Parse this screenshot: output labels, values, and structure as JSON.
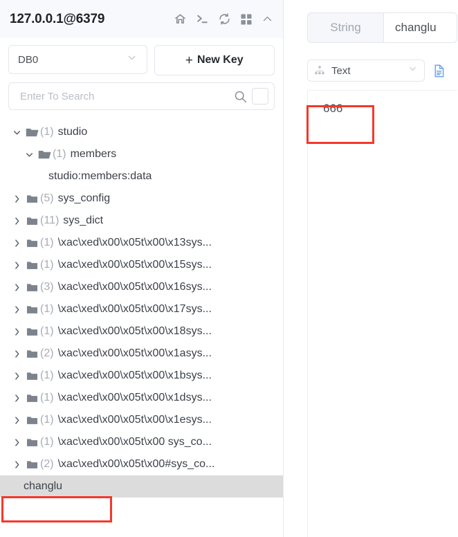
{
  "connection": {
    "title": "127.0.0.1@6379",
    "icons": [
      {
        "name": "home-icon",
        "glyph": "home"
      },
      {
        "name": "console-icon",
        "glyph": "terminal"
      },
      {
        "name": "refresh-icon",
        "glyph": "refresh"
      },
      {
        "name": "grid-icon",
        "glyph": "grid"
      },
      {
        "name": "collapse-icon",
        "glyph": "chevron-up"
      }
    ]
  },
  "toolbar": {
    "db_value": "DB0",
    "new_key_plus": "+",
    "new_key_label": "New Key"
  },
  "search": {
    "placeholder": "Enter To Search",
    "value": ""
  },
  "tree": {
    "nodes": [
      {
        "indent": 0,
        "state": "expanded",
        "folder": "open",
        "count": "(1)",
        "name": "studio",
        "selected": false
      },
      {
        "indent": 1,
        "state": "expanded",
        "folder": "open",
        "count": "(1)",
        "name": "members",
        "selected": false
      },
      {
        "indent": 2,
        "state": "leaf",
        "folder": "none",
        "count": "",
        "name": "studio:members:data",
        "selected": false
      },
      {
        "indent": 0,
        "state": "collapsed",
        "folder": "closed",
        "count": "(5)",
        "name": "sys_config",
        "selected": false
      },
      {
        "indent": 0,
        "state": "collapsed",
        "folder": "closed",
        "count": "(11)",
        "name": "sys_dict",
        "selected": false
      },
      {
        "indent": 0,
        "state": "collapsed",
        "folder": "closed",
        "count": "(1)",
        "name": "\\xac\\xed\\x00\\x05t\\x00\\x13sys...",
        "selected": false
      },
      {
        "indent": 0,
        "state": "collapsed",
        "folder": "closed",
        "count": "(1)",
        "name": "\\xac\\xed\\x00\\x05t\\x00\\x15sys...",
        "selected": false
      },
      {
        "indent": 0,
        "state": "collapsed",
        "folder": "closed",
        "count": "(3)",
        "name": "\\xac\\xed\\x00\\x05t\\x00\\x16sys...",
        "selected": false
      },
      {
        "indent": 0,
        "state": "collapsed",
        "folder": "closed",
        "count": "(1)",
        "name": "\\xac\\xed\\x00\\x05t\\x00\\x17sys...",
        "selected": false
      },
      {
        "indent": 0,
        "state": "collapsed",
        "folder": "closed",
        "count": "(1)",
        "name": "\\xac\\xed\\x00\\x05t\\x00\\x18sys...",
        "selected": false
      },
      {
        "indent": 0,
        "state": "collapsed",
        "folder": "closed",
        "count": "(2)",
        "name": "\\xac\\xed\\x00\\x05t\\x00\\x1asys...",
        "selected": false
      },
      {
        "indent": 0,
        "state": "collapsed",
        "folder": "closed",
        "count": "(1)",
        "name": "\\xac\\xed\\x00\\x05t\\x00\\x1bsys...",
        "selected": false
      },
      {
        "indent": 0,
        "state": "collapsed",
        "folder": "closed",
        "count": "(1)",
        "name": "\\xac\\xed\\x00\\x05t\\x00\\x1dsys...",
        "selected": false
      },
      {
        "indent": 0,
        "state": "collapsed",
        "folder": "closed",
        "count": "(1)",
        "name": "\\xac\\xed\\x00\\x05t\\x00\\x1esys...",
        "selected": false
      },
      {
        "indent": 0,
        "state": "collapsed",
        "folder": "closed",
        "count": "(1)",
        "name": "\\xac\\xed\\x00\\x05t\\x00 sys_co...",
        "selected": false
      },
      {
        "indent": 0,
        "state": "collapsed",
        "folder": "closed",
        "count": "(2)",
        "name": "\\xac\\xed\\x00\\x05t\\x00#sys_co...",
        "selected": false
      },
      {
        "indent": 0,
        "state": "leaf",
        "folder": "none",
        "count": "",
        "name": "changlu",
        "selected": true
      }
    ]
  },
  "detail": {
    "key_type": "String",
    "key_name": "changlu",
    "format_value": "Text",
    "value": "666"
  },
  "annotations": {
    "accent_color": "#f5372b",
    "boxes": [
      "value-666",
      "tree-item-changlu"
    ]
  }
}
